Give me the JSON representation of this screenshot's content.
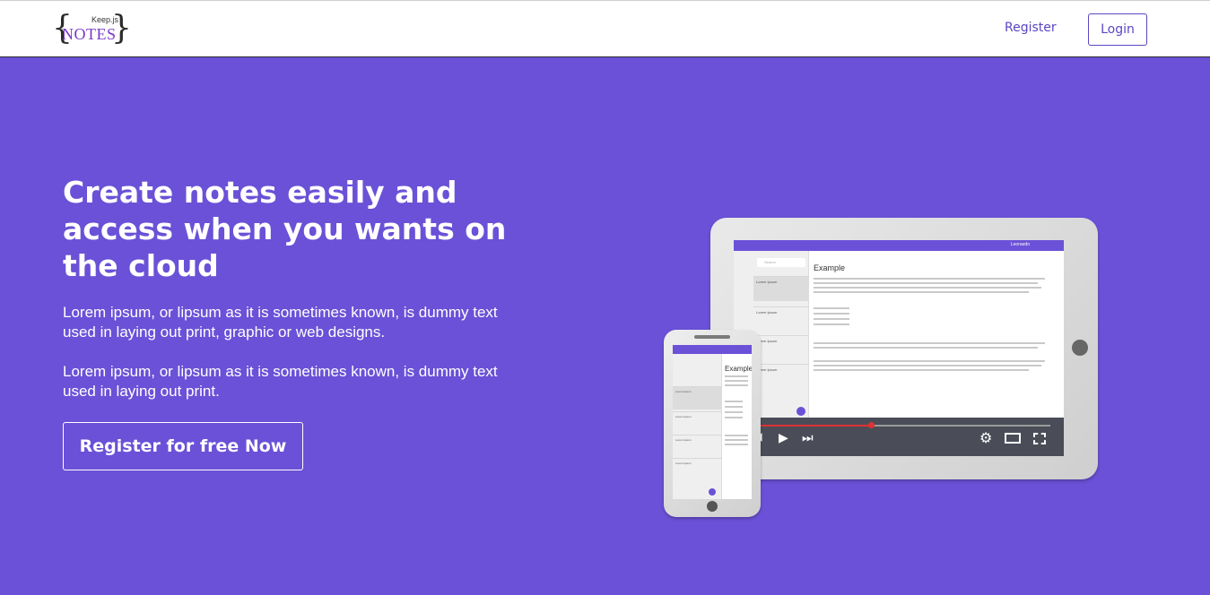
{
  "nav": {
    "logo": {
      "top": "Keep.js",
      "word": "NOTES",
      "open": "{",
      "close": "}"
    },
    "register_label": "Register",
    "login_label": "Login"
  },
  "hero": {
    "title": "Create notes easily and access when you wants on the cloud",
    "paragraph_1": "Lorem ipsum, or lipsum as it is sometimes known, is dummy text used in laying out print, graphic or web designs.",
    "paragraph_2": "Lorem ipsum, or lipsum as it is sometimes known, is dummy text used in laying out print.",
    "cta_label": "Register for free Now"
  },
  "illustration": {
    "tablet": {
      "note_heading": "Example",
      "search_placeholder": "Search",
      "user": "Leonardo",
      "notes": [
        "Lorem Ipsum",
        "Lorem Ipsum",
        "Lorem Ipsum",
        "Lorem Ipsum"
      ],
      "player_progress": 0.38
    },
    "phone": {
      "note_heading": "Example",
      "notes": [
        "Lorem Ipsum",
        "Lorem Ipsum",
        "Lorem Ipsum",
        "Lorem Ipsum"
      ]
    }
  },
  "colors": {
    "accent": "#6a51d7",
    "link": "#5a46c4",
    "progress": "#e03131"
  }
}
